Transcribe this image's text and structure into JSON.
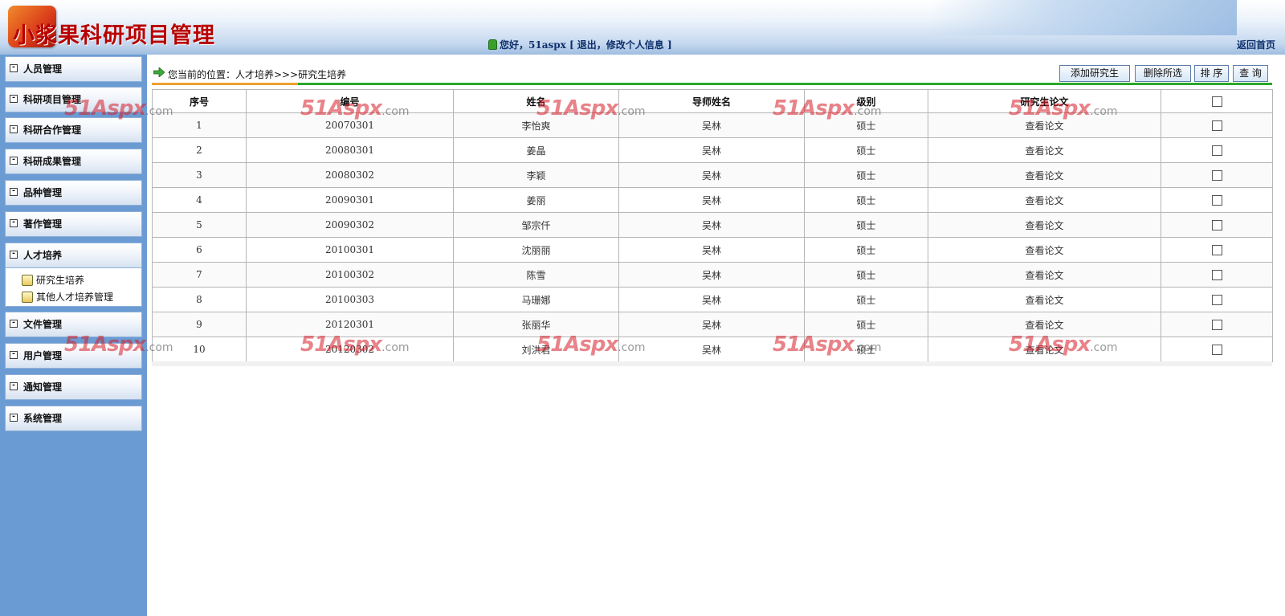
{
  "header": {
    "logo_text": "小浆果科研项目管理",
    "greeting": "您好，51aspx [ 退出，修改个人信息  ]",
    "home_link": "返回首页"
  },
  "sidebar": {
    "items": [
      {
        "label": "人员管理"
      },
      {
        "label": "科研项目管理"
      },
      {
        "label": "科研合作管理"
      },
      {
        "label": "科研成果管理"
      },
      {
        "label": "品种管理"
      },
      {
        "label": "著作管理"
      },
      {
        "label": "人才培养"
      },
      {
        "label": "文件管理"
      },
      {
        "label": "用户管理"
      },
      {
        "label": "通知管理"
      },
      {
        "label": "系统管理"
      }
    ],
    "sub_items": [
      {
        "label": "研究生培养"
      },
      {
        "label": "其他人才培养管理"
      }
    ]
  },
  "breadcrumb": {
    "text": "您当前的位置：人才培养>>>研究生培养"
  },
  "toolbar": {
    "add_label": "添加研究生",
    "delete_label": "删除所选",
    "sort_label": "排 序",
    "query_label": "查 询"
  },
  "table": {
    "columns": [
      "序号",
      "编号",
      "姓名",
      "导师姓名",
      "级别",
      "研究生论文"
    ],
    "rows": [
      {
        "no": "1",
        "id": "20070301",
        "name": "李怡爽",
        "tutor": "吴林",
        "level": "硕士",
        "thesis": "查看论文"
      },
      {
        "no": "2",
        "id": "20080301",
        "name": "姜晶",
        "tutor": "吴林",
        "level": "硕士",
        "thesis": "查看论文"
      },
      {
        "no": "3",
        "id": "20080302",
        "name": "李颖",
        "tutor": "吴林",
        "level": "硕士",
        "thesis": "查看论文"
      },
      {
        "no": "4",
        "id": "20090301",
        "name": "姜丽",
        "tutor": "吴林",
        "level": "硕士",
        "thesis": "查看论文"
      },
      {
        "no": "5",
        "id": "20090302",
        "name": "邹宗仟",
        "tutor": "吴林",
        "level": "硕士",
        "thesis": "查看论文"
      },
      {
        "no": "6",
        "id": "20100301",
        "name": "沈丽丽",
        "tutor": "吴林",
        "level": "硕士",
        "thesis": "查看论文"
      },
      {
        "no": "7",
        "id": "20100302",
        "name": "陈雪",
        "tutor": "吴林",
        "level": "硕士",
        "thesis": "查看论文"
      },
      {
        "no": "8",
        "id": "20100303",
        "name": "马珊娜",
        "tutor": "吴林",
        "level": "硕士",
        "thesis": "查看论文"
      },
      {
        "no": "9",
        "id": "20120301",
        "name": "张丽华",
        "tutor": "吴林",
        "level": "硕士",
        "thesis": "查看论文"
      },
      {
        "no": "10",
        "id": "20120302",
        "name": "刘洪君",
        "tutor": "吴林",
        "level": "硕士",
        "thesis": "查看论文"
      }
    ]
  },
  "watermark": {
    "main": "51Aspx",
    "suffix": ".com"
  },
  "colors": {
    "sidebar_bg": "#6b9bd3",
    "accent_orange": "#f0a030",
    "accent_green": "#2aa82a",
    "logo_red": "#b80000"
  }
}
